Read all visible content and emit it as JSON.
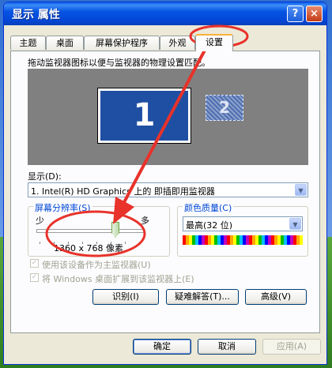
{
  "window": {
    "title": "显示 属性",
    "help_glyph": "?",
    "close_glyph": "×"
  },
  "tabs": [
    "主题",
    "桌面",
    "屏幕保护程序",
    "外观",
    "设置"
  ],
  "active_tab": "设置",
  "settings": {
    "instruction": "拖动监视器图标以便与监视器的物理设置匹配。",
    "monitor1_label": "1",
    "monitor2_label": "2",
    "display_label": "显示(D):",
    "display_value": "1. Intel(R) HD Graphics 上的 即插即用监视器",
    "resolution": {
      "group_label": "屏幕分辨率(S)",
      "less_label": "少",
      "more_label": "多",
      "value_text": "1360 x 768 像素",
      "slider_fraction": 0.8
    },
    "color_quality": {
      "group_label": "颜色质量(C)",
      "value": "最高(32 位)"
    },
    "checkbox_primary": "使用该设备作为主监视器(U)",
    "checkbox_extend": "将 Windows 桌面扩展到该监视器上(E)",
    "buttons": {
      "identify": "识别(I)",
      "troubleshoot": "疑难解答(T)...",
      "advanced": "高级(V)"
    }
  },
  "footer": {
    "ok": "确定",
    "cancel": "取消",
    "apply": "应用(A)"
  },
  "colors": {
    "titlebar": "#0054e3",
    "annotation_red": "#e8322a",
    "group_label": "#0046d5",
    "monitor_primary": "#1f4fa3"
  }
}
